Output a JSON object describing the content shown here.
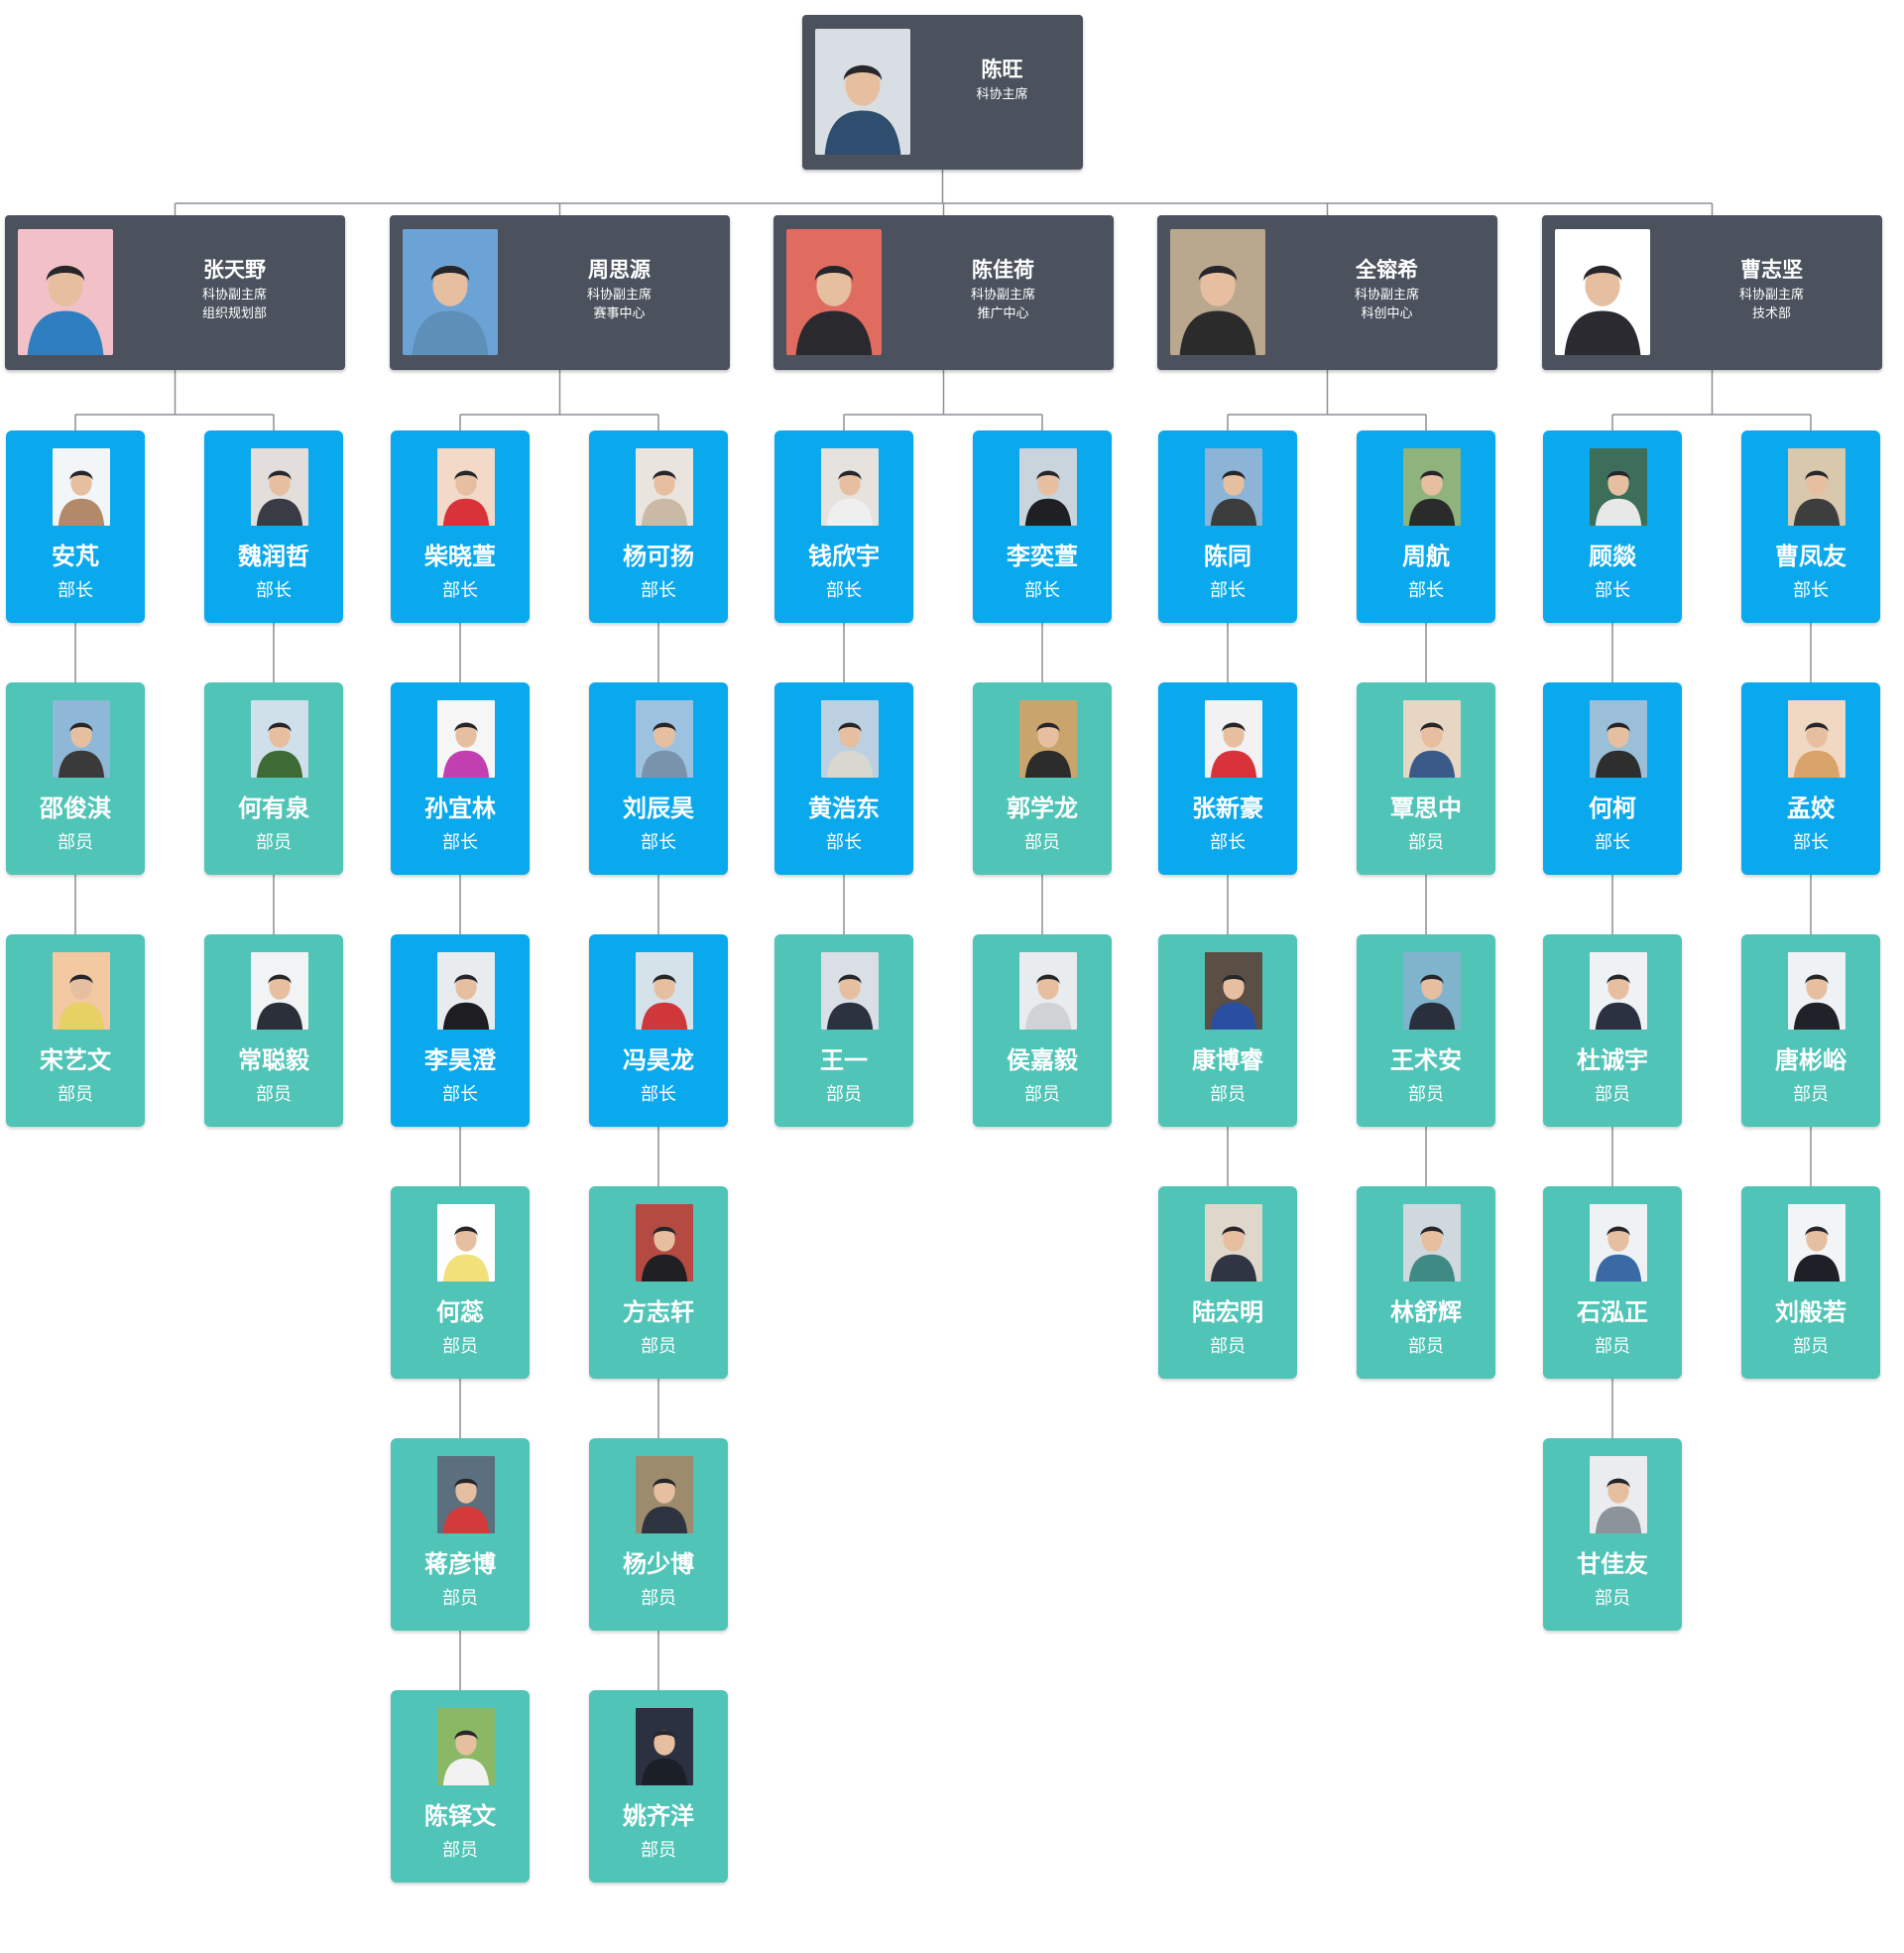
{
  "chart_data": {
    "type": "org-chart",
    "root": {
      "name": "陈旺",
      "title": "科协主席",
      "colors": [
        "#d9dee4",
        "#2f4d6e"
      ]
    },
    "vice_chairs": [
      {
        "name": "张天野",
        "title": "科协副主席",
        "dept": "组织规划部",
        "colors": [
          "#f2c1c7",
          "#2f7fc0"
        ],
        "heads": [
          {
            "name": "安芃",
            "role": "部长",
            "style": "blue",
            "colors": [
              "#f3f6f8",
              "#b28a6a"
            ],
            "members": [
              {
                "name": "邵俊淇",
                "role": "部员",
                "style": "teal",
                "colors": [
                  "#8fb7d8",
                  "#3a3a3a"
                ]
              },
              {
                "name": "宋艺文",
                "role": "部员",
                "style": "teal",
                "colors": [
                  "#f3c9a2",
                  "#e7d064"
                ]
              }
            ]
          },
          {
            "name": "魏润哲",
            "role": "部长",
            "style": "blue",
            "colors": [
              "#e3dedb",
              "#3b3b46"
            ],
            "members": [
              {
                "name": "何有泉",
                "role": "部员",
                "style": "teal",
                "colors": [
                  "#cfe0ea",
                  "#3d6a35"
                ]
              },
              {
                "name": "常聪毅",
                "role": "部员",
                "style": "teal",
                "colors": [
                  "#f1f3f5",
                  "#2a2f3a"
                ]
              }
            ]
          }
        ]
      },
      {
        "name": "周思源",
        "title": "科协副主席",
        "dept": "赛事中心",
        "colors": [
          "#6ba3d6",
          "#5e8fb9"
        ],
        "heads": [
          {
            "name": "柴晓萱",
            "role": "部长",
            "style": "blue",
            "colors": [
              "#f2d9c8",
              "#d9333a"
            ],
            "members": [
              {
                "name": "孙宜林",
                "role": "部长",
                "style": "blue",
                "colors": [
                  "#f6f6f6",
                  "#c13fb0"
                ]
              },
              {
                "name": "李昊澄",
                "role": "部长",
                "style": "blue",
                "colors": [
                  "#e8ecef",
                  "#1d1d22"
                ]
              },
              {
                "name": "何蕊",
                "role": "部员",
                "style": "teal",
                "colors": [
                  "#ffffff",
                  "#f2e07a"
                ]
              },
              {
                "name": "蒋彦博",
                "role": "部员",
                "style": "teal",
                "colors": [
                  "#5c6f7e",
                  "#d33a3a"
                ]
              },
              {
                "name": "陈铎文",
                "role": "部员",
                "style": "teal",
                "colors": [
                  "#8ab865",
                  "#f2f2f2"
                ]
              }
            ]
          },
          {
            "name": "杨可扬",
            "role": "部长",
            "style": "blue",
            "colors": [
              "#e9e4de",
              "#c9b9a5"
            ],
            "members": [
              {
                "name": "刘辰昊",
                "role": "部长",
                "style": "blue",
                "colors": [
                  "#9cc2df",
                  "#7a93ad"
                ]
              },
              {
                "name": "冯昊龙",
                "role": "部长",
                "style": "blue",
                "colors": [
                  "#d6e2ea",
                  "#d0373a"
                ]
              },
              {
                "name": "方志轩",
                "role": "部员",
                "style": "teal",
                "colors": [
                  "#b54a43",
                  "#1f1f24"
                ]
              },
              {
                "name": "杨少博",
                "role": "部员",
                "style": "teal",
                "colors": [
                  "#9d8b6e",
                  "#2d3440"
                ]
              },
              {
                "name": "姚齐洋",
                "role": "部员",
                "style": "teal",
                "colors": [
                  "#2b3140",
                  "#1b1f28"
                ]
              }
            ]
          }
        ]
      },
      {
        "name": "陈佳荷",
        "title": "科协副主席",
        "dept": "推广中心",
        "colors": [
          "#e06b5f",
          "#2a2a2e"
        ],
        "heads": [
          {
            "name": "钱欣宇",
            "role": "部长",
            "style": "blue",
            "colors": [
              "#e6e2de",
              "#efefef"
            ],
            "members": [
              {
                "name": "黄浩东",
                "role": "部长",
                "style": "blue",
                "colors": [
                  "#bcd0e2",
                  "#d8d8d0"
                ]
              },
              {
                "name": "王一",
                "role": "部员",
                "style": "teal",
                "colors": [
                  "#d9dfe4",
                  "#2c3340"
                ]
              }
            ]
          },
          {
            "name": "李奕萱",
            "role": "部长",
            "style": "blue",
            "colors": [
              "#c9d4dc",
              "#1f1f24"
            ],
            "members": [
              {
                "name": "郭学龙",
                "role": "部员",
                "style": "teal",
                "colors": [
                  "#caa46d",
                  "#2c2c2c"
                ]
              },
              {
                "name": "侯嘉毅",
                "role": "部员",
                "style": "teal",
                "colors": [
                  "#e9ecee",
                  "#cfd3d6"
                ]
              }
            ]
          }
        ]
      },
      {
        "name": "全镕希",
        "title": "科协副主席",
        "dept": "科创中心",
        "colors": [
          "#b9a88e",
          "#2b2b2b"
        ],
        "heads": [
          {
            "name": "陈同",
            "role": "部长",
            "style": "blue",
            "colors": [
              "#8bb4d6",
              "#3c3c3c"
            ],
            "members": [
              {
                "name": "张新豪",
                "role": "部长",
                "style": "blue",
                "colors": [
                  "#f2f2f2",
                  "#d8333a"
                ]
              },
              {
                "name": "康博睿",
                "role": "部员",
                "style": "teal",
                "colors": [
                  "#5a4e45",
                  "#2a4fa2"
                ]
              },
              {
                "name": "陆宏明",
                "role": "部员",
                "style": "teal",
                "colors": [
                  "#ded7ca",
                  "#2f3542"
                ]
              }
            ]
          },
          {
            "name": "周航",
            "role": "部长",
            "style": "blue",
            "colors": [
              "#8fb37d",
              "#2b2b2b"
            ],
            "members": [
              {
                "name": "覃思中",
                "role": "部员",
                "style": "teal",
                "colors": [
                  "#e8d6c4",
                  "#3a5a8a"
                ]
              },
              {
                "name": "王术安",
                "role": "部员",
                "style": "teal",
                "colors": [
                  "#7fb4cc",
                  "#2a2f3c"
                ]
              },
              {
                "name": "林舒辉",
                "role": "部员",
                "style": "teal",
                "colors": [
                  "#cfd8dc",
                  "#3f8a84"
                ]
              }
            ]
          }
        ]
      },
      {
        "name": "曹志坚",
        "title": "科协副主席",
        "dept": "技术部",
        "colors": [
          "#ffffff",
          "#2a2a30"
        ],
        "heads": [
          {
            "name": "顾燚",
            "role": "部长",
            "style": "blue",
            "colors": [
              "#3d6e59",
              "#e8e8e8"
            ],
            "members": [
              {
                "name": "何柯",
                "role": "部长",
                "style": "blue",
                "colors": [
                  "#9cbfd9",
                  "#2e2e2e"
                ]
              },
              {
                "name": "杜诚宇",
                "role": "部员",
                "style": "teal",
                "colors": [
                  "#eef2f5",
                  "#2b3140"
                ]
              },
              {
                "name": "石泓正",
                "role": "部员",
                "style": "teal",
                "colors": [
                  "#eef2f5",
                  "#3a6aa6"
                ]
              },
              {
                "name": "甘佳友",
                "role": "部员",
                "style": "teal",
                "colors": [
                  "#eaecef",
                  "#8d939b"
                ]
              }
            ]
          },
          {
            "name": "曹凤友",
            "role": "部长",
            "style": "blue",
            "colors": [
              "#d7c8ae",
              "#3e3e3e"
            ],
            "members": [
              {
                "name": "孟姣",
                "role": "部长",
                "style": "blue",
                "colors": [
                  "#f0d8c2",
                  "#d9a46a"
                ]
              },
              {
                "name": "唐彬峪",
                "role": "部员",
                "style": "teal",
                "colors": [
                  "#eef2f5",
                  "#1f2228"
                ]
              },
              {
                "name": "刘般若",
                "role": "部员",
                "style": "teal",
                "colors": [
                  "#f2f4f6",
                  "#1d2027"
                ]
              }
            ]
          }
        ]
      }
    ]
  }
}
